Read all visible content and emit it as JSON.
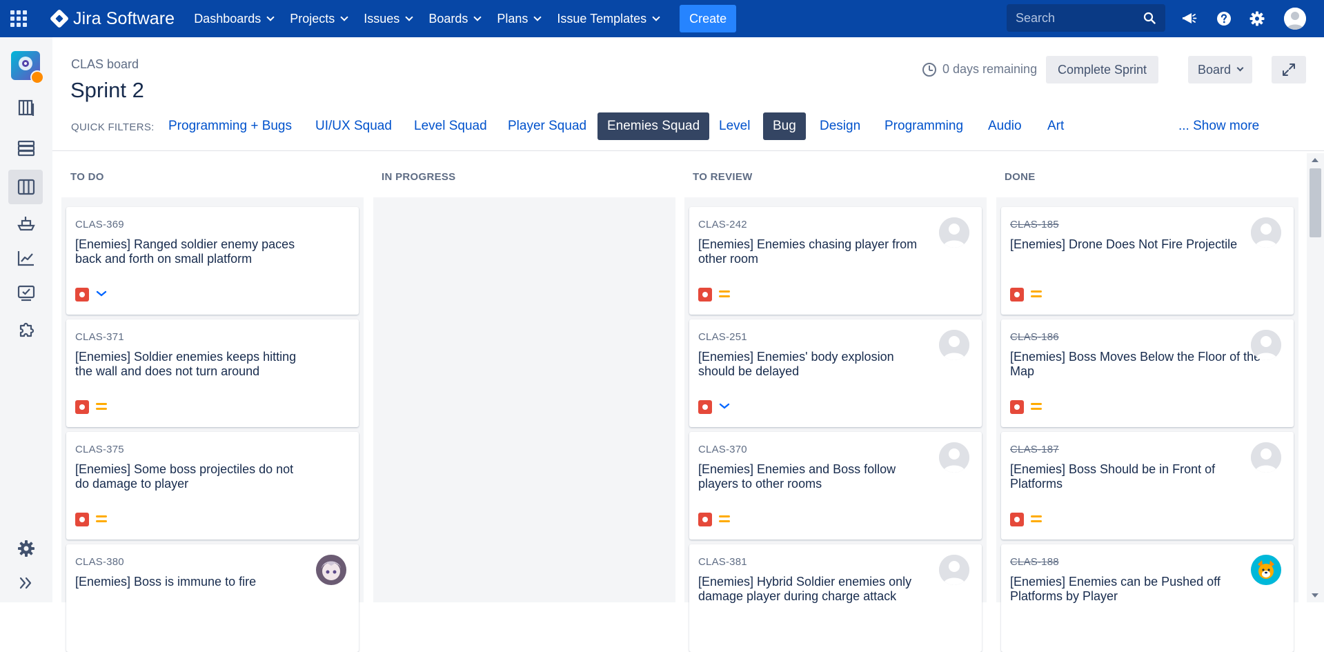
{
  "topnav": {
    "product_name": "Jira Software",
    "items": [
      {
        "label": "Dashboards"
      },
      {
        "label": "Projects"
      },
      {
        "label": "Issues"
      },
      {
        "label": "Boards"
      },
      {
        "label": "Plans"
      },
      {
        "label": "Issue Templates"
      }
    ],
    "create_label": "Create",
    "search_placeholder": "Search",
    "icons": [
      "notifications-icon",
      "help-icon",
      "settings-icon",
      "profile-avatar"
    ],
    "brand_color": "#0747a6",
    "accent_color": "#2684ff"
  },
  "sidebar": {
    "icons": [
      "project-avatar",
      "backlog-icon",
      "roadmap-icon",
      "board-icon",
      "releases-icon",
      "reports-icon",
      "issues-icon",
      "add-ons-icon",
      "settings-icon",
      "expand-sidebar-icon"
    ]
  },
  "header": {
    "breadcrumb": "CLAS board",
    "title": "Sprint 2",
    "days_remaining": "0 days remaining",
    "complete_sprint_label": "Complete Sprint",
    "board_label": "Board"
  },
  "quick_filters": {
    "label": "QUICK FILTERS:",
    "items": [
      {
        "label": "Programming + Bugs",
        "active": false
      },
      {
        "label": "UI/UX Squad",
        "active": false
      },
      {
        "label": "Level Squad",
        "active": false
      },
      {
        "label": "Player Squad",
        "active": false
      },
      {
        "label": "Enemies Squad",
        "active": true
      },
      {
        "label": "Level",
        "active": false
      },
      {
        "label": "Bug",
        "active": true
      },
      {
        "label": "Design",
        "active": false
      },
      {
        "label": "Programming",
        "active": false
      },
      {
        "label": "Audio",
        "active": false
      },
      {
        "label": "Art",
        "active": false
      }
    ],
    "show_more": "... Show more"
  },
  "columns": [
    {
      "title": "TO DO",
      "cards": [
        {
          "key": "CLAS-369",
          "summary": "[Enemies] Ranged soldier enemy paces back and forth on small platform",
          "type": "bug",
          "priority": "low",
          "assignee": "none"
        },
        {
          "key": "CLAS-371",
          "summary": "[Enemies] Soldier enemies keeps hitting the wall and does not turn around",
          "type": "bug",
          "priority": "medium",
          "assignee": "none"
        },
        {
          "key": "CLAS-375",
          "summary": "[Enemies] Some boss projectiles do not do damage to player",
          "type": "bug",
          "priority": "medium",
          "assignee": "none"
        },
        {
          "key": "CLAS-380",
          "summary": "[Enemies] Boss is immune to fire",
          "type": "bug",
          "priority": "medium",
          "assignee": "anime-avatar"
        }
      ]
    },
    {
      "title": "IN PROGRESS",
      "cards": []
    },
    {
      "title": "TO REVIEW",
      "cards": [
        {
          "key": "CLAS-242",
          "summary": "[Enemies] Enemies chasing player from other room",
          "type": "bug",
          "priority": "medium",
          "assignee": "default-avatar"
        },
        {
          "key": "CLAS-251",
          "summary": "[Enemies] Enemies' body explosion should be delayed",
          "type": "bug",
          "priority": "low",
          "assignee": "default-avatar"
        },
        {
          "key": "CLAS-370",
          "summary": "[Enemies] Enemies and Boss follow players to other rooms",
          "type": "bug",
          "priority": "medium",
          "assignee": "default-avatar"
        },
        {
          "key": "CLAS-381",
          "summary": "[Enemies] Hybrid Soldier enemies only damage player during charge attack",
          "type": "bug",
          "priority": "medium",
          "assignee": "default-avatar"
        }
      ]
    },
    {
      "title": "DONE",
      "cards": [
        {
          "key": "CLAS-185",
          "summary": "[Enemies] Drone Does Not Fire Projectile",
          "type": "bug",
          "priority": "medium",
          "assignee": "default-avatar",
          "done": true
        },
        {
          "key": "CLAS-186",
          "summary": "[Enemies] Boss Moves Below the Floor of the Map",
          "type": "bug",
          "priority": "medium",
          "assignee": "default-avatar",
          "done": true
        },
        {
          "key": "CLAS-187",
          "summary": "[Enemies] Boss Should be in Front of Platforms",
          "type": "bug",
          "priority": "medium",
          "assignee": "default-avatar",
          "done": true
        },
        {
          "key": "CLAS-188",
          "summary": "[Enemies] Enemies can be Pushed off Platforms by Player",
          "type": "bug",
          "priority": "medium",
          "assignee": "dog-avatar",
          "done": true
        }
      ]
    }
  ],
  "colors": {
    "bug": "#e5493a",
    "priority_medium": "#ffab00",
    "priority_low": "#0065ff",
    "active_filter": "#344563",
    "link": "#0052cc"
  }
}
